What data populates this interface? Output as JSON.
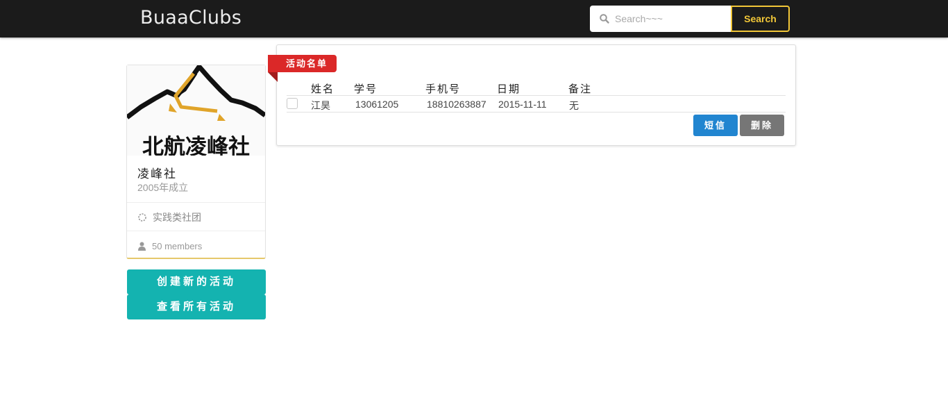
{
  "header": {
    "brand": "BuaaClubs",
    "search_placeholder": "Search~~~",
    "search_button": "Search"
  },
  "club": {
    "logo_text": "北航凌峰社",
    "name": "凌峰社",
    "founded": "2005年成立",
    "type": "实践类社团",
    "members": "50 members"
  },
  "actions": {
    "create_activity": "创建新的活动",
    "view_activities": "查看所有活动"
  },
  "roster": {
    "title": "活动名单",
    "columns": [
      "姓名",
      "学号",
      "手机号",
      "日期",
      "备注"
    ],
    "rows": [
      {
        "name": "江昊",
        "student_id": "13061205",
        "phone": "18810263887",
        "date": "2015-11-11",
        "note": "无"
      }
    ],
    "sms_button": "短信",
    "delete_button": "删除"
  },
  "colors": {
    "topbar": "#1b1b1b",
    "search_accent": "#f2c738",
    "teal": "#14b3b0",
    "ribbon_red": "#db2828",
    "sms_blue": "#2185d0",
    "delete_grey": "#767676"
  }
}
